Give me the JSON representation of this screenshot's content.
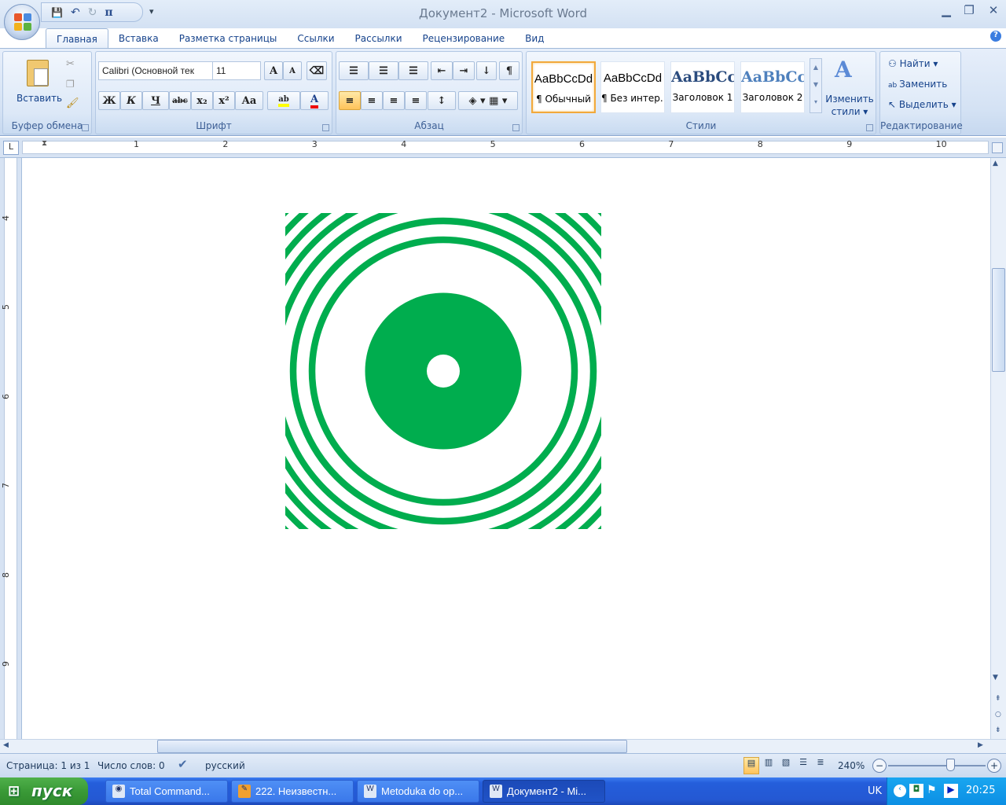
{
  "window": {
    "title": "Документ2 - Microsoft Word",
    "minimize": "▁",
    "restore": "❐",
    "close": "✕",
    "help": "?"
  },
  "qat": {
    "save": "💾",
    "undo": "↶",
    "redo": "↻",
    "pi": "π",
    "customize": "▾"
  },
  "tabs": [
    {
      "label": "Главная",
      "active": true
    },
    {
      "label": "Вставка"
    },
    {
      "label": "Разметка страницы"
    },
    {
      "label": "Ссылки"
    },
    {
      "label": "Рассылки"
    },
    {
      "label": "Рецензирование"
    },
    {
      "label": "Вид"
    }
  ],
  "clipboard": {
    "paste": "Вставить",
    "label": "Буфер обмена"
  },
  "font": {
    "name": "Calibri (Основной тек",
    "size": "11",
    "label": "Шрифт",
    "bold": "Ж",
    "italic": "К",
    "underline": "Ч",
    "strike": "abc",
    "sub": "x₂",
    "sup": "x²",
    "case": "Aa",
    "grow": "A",
    "shrink": "A",
    "highlight_color": "#ffff00",
    "font_color": "#ff0000"
  },
  "paragraph": {
    "label": "Абзац",
    "pilcrow": "¶"
  },
  "styles": {
    "label": "Стили",
    "items": [
      {
        "preview": "AaBbCcDd",
        "name": "¶ Обычный",
        "selected": true
      },
      {
        "preview": "AaBbCcDd",
        "name": "¶ Без интер..."
      },
      {
        "preview": "AaBbCc",
        "name": "Заголовок 1"
      },
      {
        "preview": "AaBbCc",
        "name": "Заголовок 2"
      }
    ],
    "change_styles": "Изменить стили ▾"
  },
  "editing": {
    "label": "Редактирование",
    "find": "Найти ▾",
    "replace": "Заменить",
    "select": "Выделить ▾"
  },
  "ruler": {
    "h_numbers": [
      "1",
      "2",
      "3",
      "4",
      "5",
      "6",
      "7",
      "8",
      "9",
      "10"
    ],
    "v_numbers": [
      "4",
      "5",
      "6",
      "7",
      "8",
      "9"
    ]
  },
  "drawing": {
    "color": "#00ad4e"
  },
  "status": {
    "page": "Страница: 1 из 1",
    "words": "Число слов: 0",
    "language": "русский",
    "zoom": "240%",
    "zoom_minus": "−",
    "zoom_plus": "+"
  },
  "taskbar": {
    "start": "пуск",
    "tasks": [
      {
        "label": "Total Command..."
      },
      {
        "label": "222. Неизвестн..."
      },
      {
        "label": "Metoduka do op..."
      },
      {
        "label": "Документ2 - Mi...",
        "active": true
      }
    ],
    "lang": "UK",
    "clock": "20:25"
  }
}
